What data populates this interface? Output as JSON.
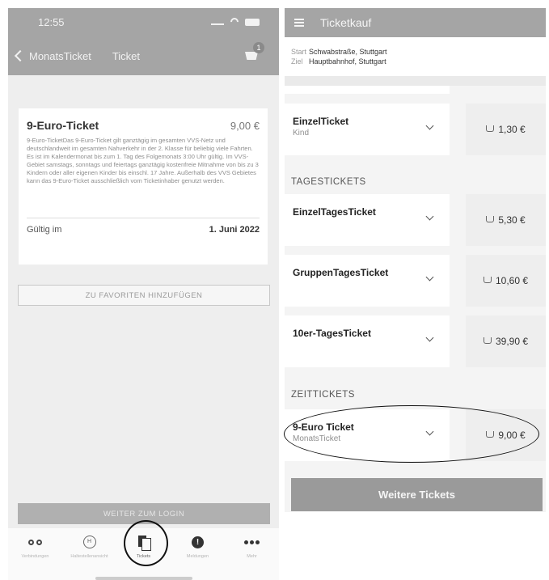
{
  "left": {
    "status_time": "12:55",
    "nav": {
      "back_label": "MonatsTicket",
      "title": "Ticket",
      "cart_badge": "1"
    },
    "ticket": {
      "title": "9-Euro-Ticket",
      "price": "9,00 €",
      "description": "9-Euro-TicketDas 9-Euro-Ticket gilt ganztägig im gesamten VVS-Netz und deutschlandweit im gesamten Nahverkehr in der 2. Klasse für beliebig viele Fahrten. Es ist im Kalendermonat bis zum 1. Tag des Folgemonats 3:00 Uhr gültig. Im VVS-Gebiet samstags, sonntags und feiertags ganztägig kostenfreie Mitnahme von bis zu 3 Kindern oder aller eigenen Kinder bis einschl. 17 Jahre. Außerhalb des VVS Gebietes kann das 9-Euro-Ticket ausschließlich vom Ticketinhaber genutzt werden.",
      "valid_label": "Gültig im",
      "valid_value": "1. Juni 2022"
    },
    "fav_button": "ZU FAVORITEN HINZUFÜGEN",
    "login_button": "WEITER ZUM LOGIN",
    "tabs": [
      {
        "label": "Verbindungen",
        "icon": "connections-icon"
      },
      {
        "label": "Haltestellenansicht",
        "icon": "stop-icon"
      },
      {
        "label": "Tickets",
        "icon": "ticket-icon"
      },
      {
        "label": "Meldungen",
        "icon": "alert-icon"
      },
      {
        "label": "Mehr",
        "icon": "more-icon"
      }
    ]
  },
  "right": {
    "title": "Ticketkauf",
    "route": {
      "start_label": "Start",
      "start": "Schwabstraße, Stuttgart",
      "ziel_label": "Ziel",
      "ziel": "Hauptbahnhof, Stuttgart"
    },
    "sections": {
      "tages": "TAGESTICKETS",
      "zeit": "ZEITTICKETS"
    },
    "rows": [
      {
        "name": "EinzelTicket",
        "sub": "Kind",
        "price": "1,30 €"
      },
      {
        "name": "EinzelTagesTicket",
        "sub": "",
        "price": "5,30 €"
      },
      {
        "name": "GruppenTagesTicket",
        "sub": "",
        "price": "10,60 €"
      },
      {
        "name": "10er-TagesTicket",
        "sub": "",
        "price": "39,90 €"
      },
      {
        "name": "9-Euro Ticket",
        "sub": "MonatsTicket",
        "price": "9,00 €"
      }
    ],
    "more_button": "Weitere Tickets"
  }
}
